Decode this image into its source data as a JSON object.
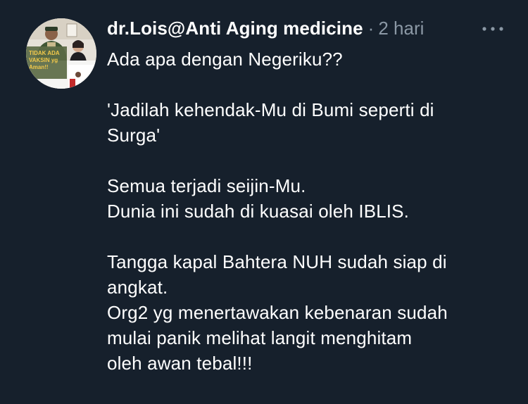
{
  "author": {
    "display_name": "dr.Lois@Anti Aging medicine",
    "separator": "·",
    "timestamp": "2 hari"
  },
  "avatar": {
    "caption_lines": [
      "TIDAK ADA",
      "VAKSIN yg",
      "Aman!!"
    ]
  },
  "more_button": {
    "icon": "more-horizontal-icon"
  },
  "tweet": {
    "lines": [
      "Ada apa dengan Negeriku??",
      "",
      "'Jadilah kehendak-Mu di Bumi seperti di",
      "Surga'",
      "",
      "Semua terjadi seijin-Mu.",
      "Dunia ini sudah di kuasai oleh IBLIS.",
      "",
      "Tangga kapal Bahtera NUH sudah siap di",
      "angkat.",
      "Org2 yg menertawakan kebenaran sudah",
      "mulai panik melihat langit menghitam",
      "oleh awan tebal!!!"
    ]
  },
  "colors": {
    "background": "#16202c",
    "text_primary": "#ffffff",
    "text_secondary": "#8b98a5"
  }
}
